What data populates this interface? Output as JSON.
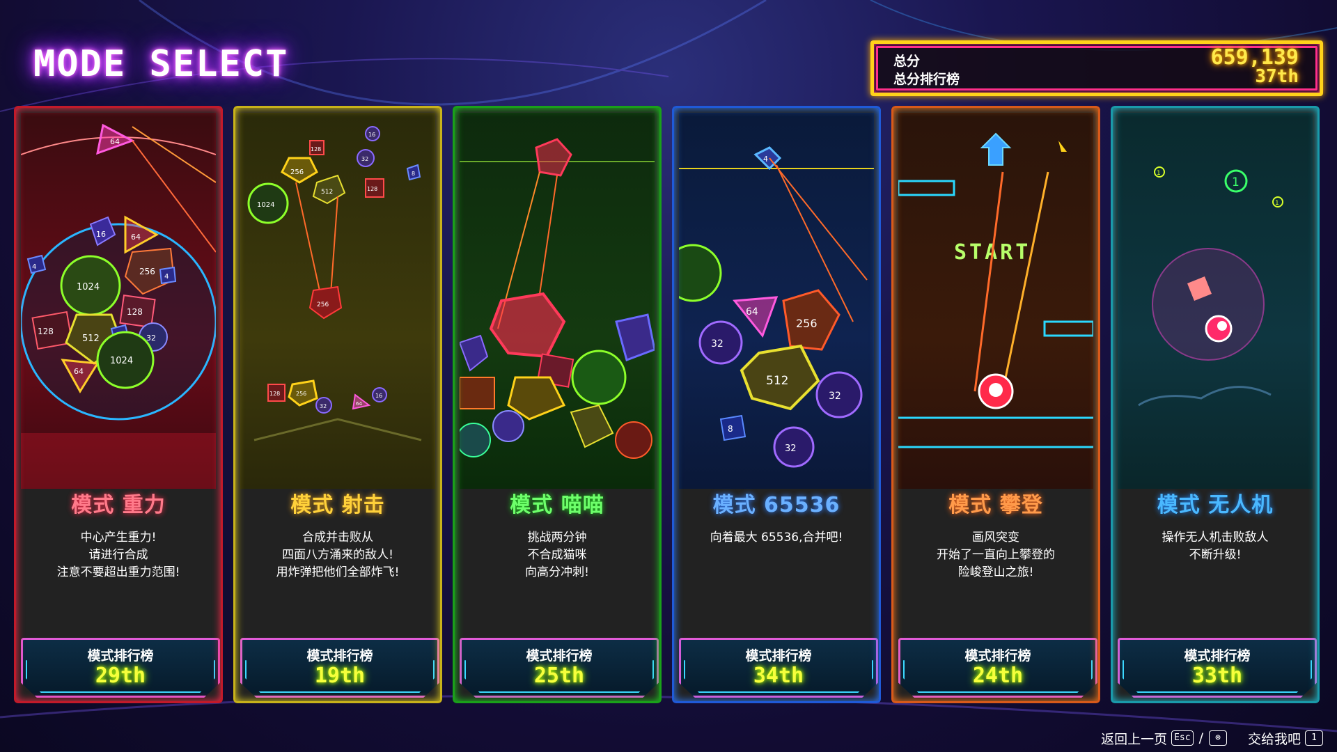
{
  "header": {
    "title": "MODE SELECT"
  },
  "score": {
    "total_label": "总分",
    "rank_label": "总分排行榜",
    "total_value": "659,139",
    "rank_value": "37th"
  },
  "cards": [
    {
      "name": "模式 重力",
      "desc": "中心产生重力!\n请进行合成\n注意不要超出重力范围!",
      "rank_label": "模式排行榜",
      "rank": "29th",
      "color": "#ff2b4b",
      "text_color": "#ff6a7d"
    },
    {
      "name": "模式 射击",
      "desc": "合成并击败从\n四面八方涌来的敌人!\n用炸弹把他们全部炸飞!",
      "rank_label": "模式排行榜",
      "rank": "19th",
      "color": "#e8d21c",
      "text_color": "#ffd13a"
    },
    {
      "name": "模式 喵喵",
      "desc": "挑战两分钟\n不合成猫咪\n向高分冲刺!",
      "rank_label": "模式排行榜",
      "rank": "25th",
      "color": "#1fd11f",
      "text_color": "#4dff5a"
    },
    {
      "name": "模式 65536",
      "desc": "向着最大 65536,合并吧!",
      "rank_label": "模式排行榜",
      "rank": "34th",
      "color": "#2f7dff",
      "text_color": "#66a8ff"
    },
    {
      "name": "模式 攀登",
      "desc": "画风突变\n开始了一直向上攀登的\n险峻登山之旅!",
      "rank_label": "模式排行榜",
      "rank": "24th",
      "color": "#ff7a1a",
      "text_color": "#ff8f3a"
    },
    {
      "name": "模式 无人机",
      "desc": "操作无人机击败敌人\n不断升级!",
      "rank_label": "模式排行榜",
      "rank": "33th",
      "color": "#1fc2d6",
      "text_color": "#4ac4ff"
    }
  ],
  "art": {
    "gravity_numbers": [
      "64",
      "16",
      "64",
      "256",
      "1024",
      "128",
      "128",
      "512",
      "8",
      "32",
      "64",
      "1024",
      "4",
      "4"
    ],
    "shoot_numbers": [
      "128",
      "16",
      "256",
      "512",
      "1024",
      "32",
      "128",
      "8",
      "256",
      "128",
      "256",
      "32",
      "16",
      "64"
    ],
    "m65536_numbers": [
      "4",
      "64",
      "256",
      "32",
      "512",
      "32",
      "8",
      "32"
    ],
    "climb_text": "START",
    "drone_numbers": [
      "1",
      "1",
      "1"
    ]
  },
  "footer": {
    "back": "返回上一页",
    "back_key": "Esc",
    "cancel_key": "⊗",
    "delegate": "交给我吧",
    "delegate_key": "1"
  }
}
